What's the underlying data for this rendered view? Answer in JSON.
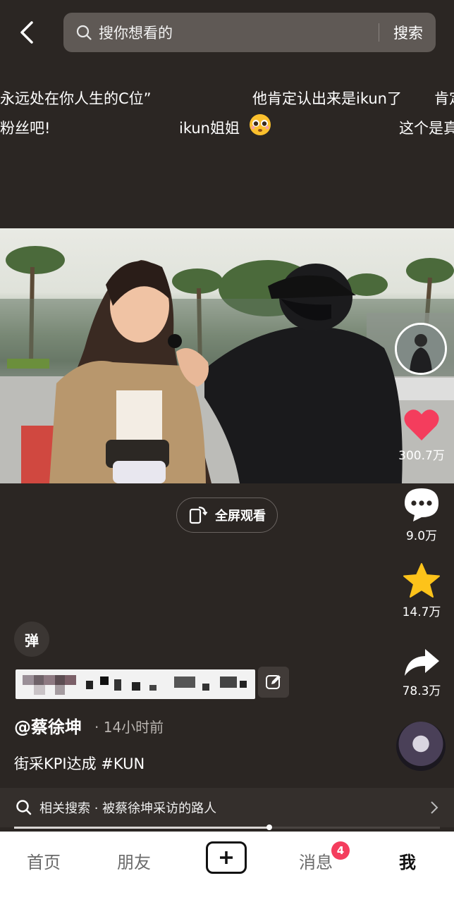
{
  "header": {
    "search_placeholder": "搜你想看的",
    "search_button": "搜索"
  },
  "danmaku": [
    "永远处在你人生的C位”",
    "他肯定认出来是ikun了",
    "肯定",
    "粉丝吧!",
    "ikun姐姐",
    "这个是真"
  ],
  "actions": {
    "likes": "300.7万",
    "comments": "9.0万",
    "favorites": "14.7万",
    "shares": "78.3万"
  },
  "fullscreen_label": "全屏观看",
  "danmaku_toggle": "弹",
  "author": "@蔡徐坤",
  "time_ago": "· 14小时前",
  "caption": "街采KPI达成 #KUN",
  "related_search": "相关搜索 · 被蔡徐坤采访的路人",
  "progress": 0.6,
  "tabs": {
    "home": "首页",
    "friends": "朋友",
    "messages": "消息",
    "me": "我"
  },
  "message_badge": "4",
  "colors": {
    "accent": "#f43d5d",
    "star": "#fdc31a",
    "background": "#2b2623"
  }
}
